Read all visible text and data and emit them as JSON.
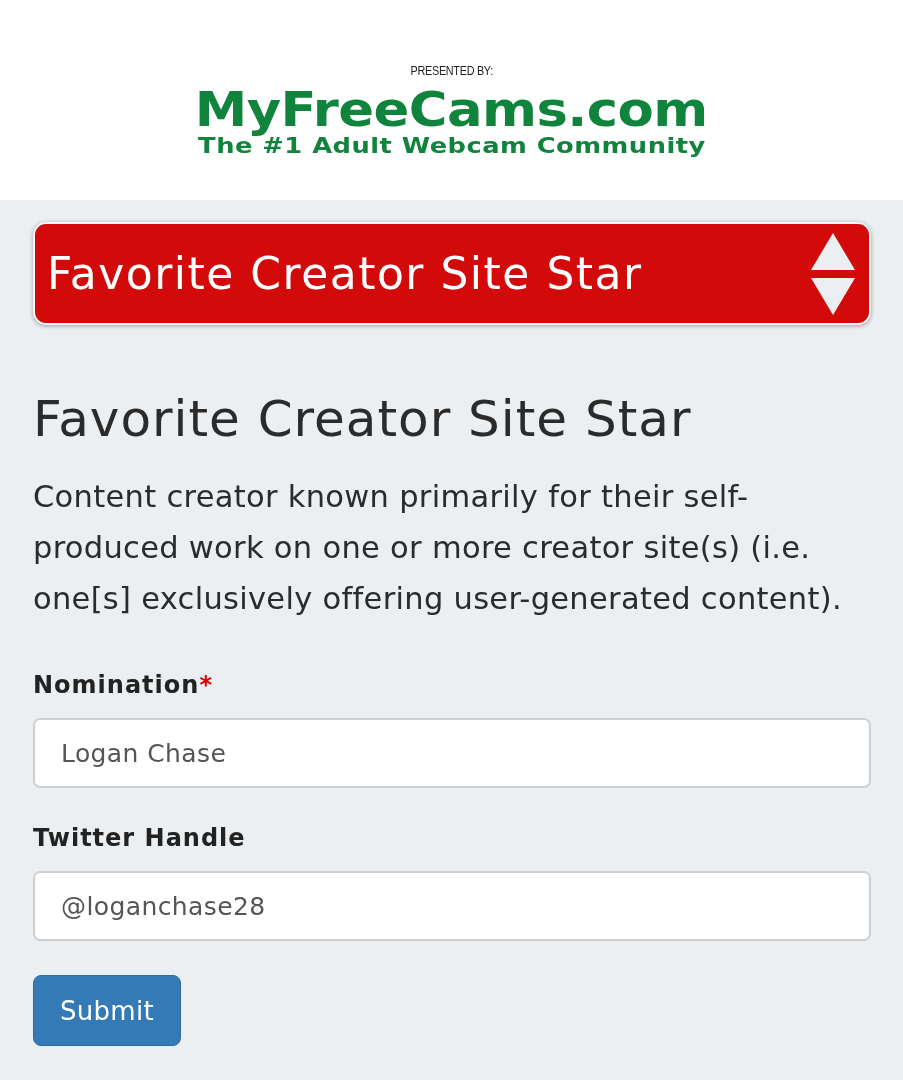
{
  "header": {
    "presented_by": "PRESENTED BY:",
    "logo_name": "MyFreeCams.com",
    "logo_tagline": "The #1 Adult Webcam Community"
  },
  "category_select": {
    "value": "Favorite Creator Site Star"
  },
  "title": "Favorite Creator Site Star",
  "description": "Content creator known primarily for their self-produced work on one or more creator site(s) (i.e. one[s] exclusively offering user-generated content).",
  "fields": [
    {
      "label": "Nomination",
      "required_mark": "*",
      "value": "Logan Chase"
    },
    {
      "label": "Twitter Handle",
      "value": "@loganchase28"
    }
  ],
  "submit_button": "Submit"
}
